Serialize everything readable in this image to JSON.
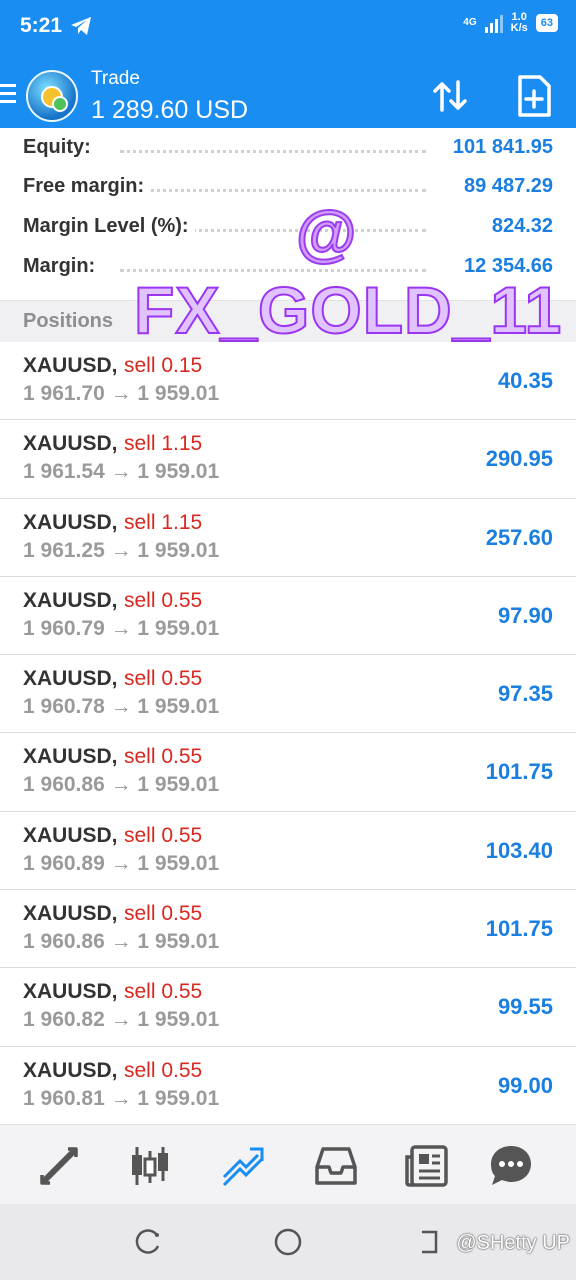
{
  "status_bar": {
    "time": "5:21",
    "network_type": "4G",
    "net_speed_value": "1.0",
    "net_speed_unit": "K/s",
    "battery": "63"
  },
  "app_bar": {
    "account_label": "Trade",
    "balance": "1 289.60 USD",
    "icons": [
      "menu-icon",
      "app-logo",
      "sort-icon",
      "new-order-icon"
    ]
  },
  "summary": {
    "rows": [
      {
        "label": "Equity:",
        "value": "101 841.95"
      },
      {
        "label": "Free margin:",
        "value": "89 487.29"
      },
      {
        "label": "Margin Level (%):",
        "value": "824.32"
      },
      {
        "label": "Margin:",
        "value": "12 354.66"
      }
    ]
  },
  "watermark": {
    "at": "@",
    "tag": "FX_GOLD_11"
  },
  "positions_header": "Positions",
  "positions": [
    {
      "symbol": "XAUUSD,",
      "side": "sell 0.15",
      "prices": "1 961.70 → 1 959.01",
      "profit": "40.35"
    },
    {
      "symbol": "XAUUSD,",
      "side": "sell 1.15",
      "prices": "1 961.54 → 1 959.01",
      "profit": "290.95"
    },
    {
      "symbol": "XAUUSD,",
      "side": "sell 1.15",
      "prices": "1 961.25 → 1 959.01",
      "profit": "257.60"
    },
    {
      "symbol": "XAUUSD,",
      "side": "sell 0.55",
      "prices": "1 960.79 → 1 959.01",
      "profit": "97.90"
    },
    {
      "symbol": "XAUUSD,",
      "side": "sell 0.55",
      "prices": "1 960.78 → 1 959.01",
      "profit": "97.35"
    },
    {
      "symbol": "XAUUSD,",
      "side": "sell 0.55",
      "prices": "1 960.86 → 1 959.01",
      "profit": "101.75"
    },
    {
      "symbol": "XAUUSD,",
      "side": "sell 0.55",
      "prices": "1 960.89 → 1 959.01",
      "profit": "103.40"
    },
    {
      "symbol": "XAUUSD,",
      "side": "sell 0.55",
      "prices": "1 960.86 → 1 959.01",
      "profit": "101.75"
    },
    {
      "symbol": "XAUUSD,",
      "side": "sell 0.55",
      "prices": "1 960.82 → 1 959.01",
      "profit": "99.55"
    },
    {
      "symbol": "XAUUSD,",
      "side": "sell 0.55",
      "prices": "1 960.81 → 1 959.01",
      "profit": "99.00"
    }
  ],
  "tab_bar": {
    "tabs": [
      "quotes-icon",
      "chart-icon",
      "trade-icon",
      "history-icon",
      "news-icon",
      "chat-icon"
    ],
    "active": "trade-icon"
  },
  "system_nav": {
    "buttons": [
      "recents-icon",
      "home-icon",
      "back-icon"
    ],
    "credit": "@SHetty UP"
  },
  "colors": {
    "accent": "#1a8df2",
    "profit": "#1a7fe0",
    "sell": "#d9281f",
    "watermark": "#9a35f2"
  }
}
